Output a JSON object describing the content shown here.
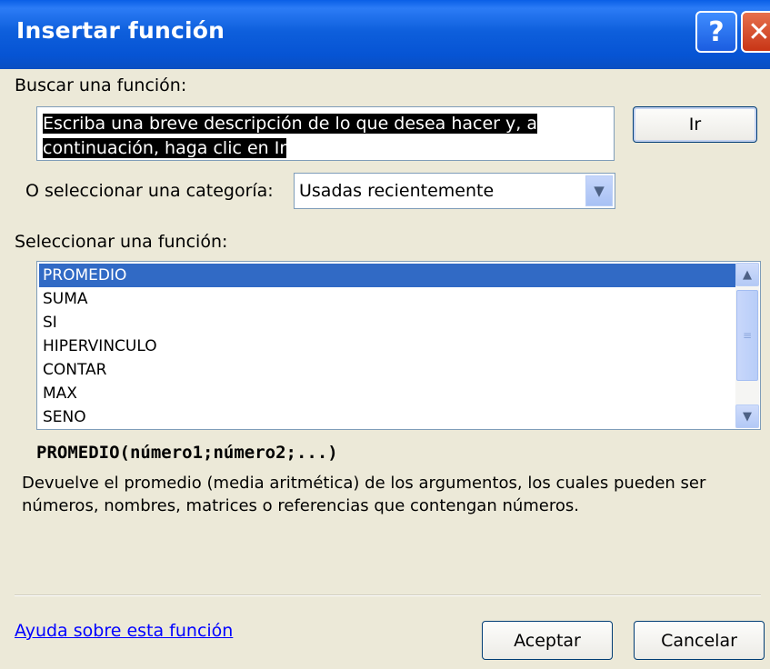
{
  "window": {
    "title": "Insertar función",
    "help_glyph": "?",
    "close_glyph": "✕"
  },
  "search": {
    "label": "Buscar una función:",
    "placeholder_selected": "Escriba una breve descripción de lo que desea hacer y, a continuación, haga clic en Ir",
    "go_label": "Ir"
  },
  "category": {
    "label": "O seleccionar una categoría:",
    "selected": "Usadas recientemente"
  },
  "functions": {
    "label": "Seleccionar una función:",
    "items": [
      "PROMEDIO",
      "SUMA",
      "SI",
      "HIPERVINCULO",
      "CONTAR",
      "MAX",
      "SENO"
    ],
    "selected_index": 0
  },
  "details": {
    "signature": "PROMEDIO(número1;número2;...)",
    "description": "Devuelve el promedio (media aritmética) de los argumentos, los cuales pueden ser números, nombres, matrices o referencias que contengan números."
  },
  "footer": {
    "help_link": "Ayuda sobre esta función",
    "ok_label": "Aceptar",
    "cancel_label": "Cancelar"
  },
  "icons": {
    "help": "help-icon",
    "close": "close-icon",
    "dropdown": "chevron-down-icon",
    "scroll_up": "chevron-up-icon",
    "scroll_down": "chevron-down-icon"
  }
}
